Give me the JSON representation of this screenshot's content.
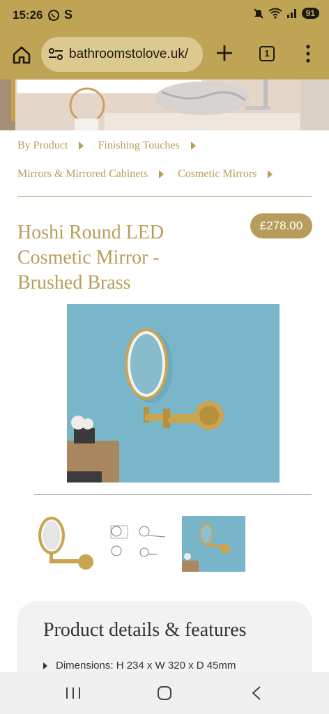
{
  "status_bar": {
    "time": "15:26",
    "battery": "91",
    "left_icons": [
      "whatsapp-icon",
      "s-app-icon"
    ],
    "right_icons": [
      "mute-icon",
      "wifi-icon",
      "signal-icon"
    ]
  },
  "browser": {
    "url": "bathroomstolove.uk/",
    "tab_count": "1"
  },
  "breadcrumb": {
    "items": [
      "By Product",
      "Finishing Touches",
      "Mirrors & Mirrored Cabinets",
      "Cosmetic Mirrors"
    ]
  },
  "product": {
    "title_lines": [
      "Hoshi Round LED",
      "Cosmetic Mirror -",
      "Brushed Brass"
    ],
    "price": "£278.00"
  },
  "details": {
    "heading": "Product details & features",
    "items": [
      "Dimensions: H 234 x W 320 x D 45mm"
    ]
  },
  "colors": {
    "brand_gold": "#c0a456",
    "accent_text": "#b89d5a",
    "price_badge": "#b89d5a"
  }
}
